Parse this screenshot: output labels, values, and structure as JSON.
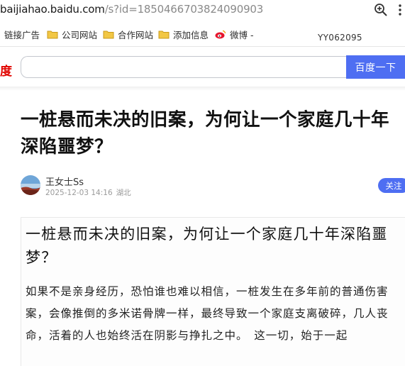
{
  "browser": {
    "url_host": "baijiahao.baidu.com",
    "url_rest": "/s?id=1850466703824090903",
    "zoom_icon": "zoom-in-icon",
    "menu_icon": "more-vertical-icon"
  },
  "bookmarks": {
    "items": [
      {
        "label": "链接广告"
      },
      {
        "label": "公司网站"
      },
      {
        "label": "合作网站"
      },
      {
        "label": "添加信息"
      },
      {
        "label": "微博 -"
      }
    ],
    "right_text": "YY062095"
  },
  "search": {
    "logo_fragment": "度",
    "input_value": "",
    "button_label": "百度一下"
  },
  "article": {
    "title": "一桩悬而未决的旧案，为何让一个家庭几十年深陷噩梦？",
    "author": "王女士Ss",
    "date": "2025-12-03 14:16",
    "location": "湖北",
    "follow_label": "关注",
    "image_title": "一桩悬而未决的旧案，为何让一个家庭几十年深陷噩梦？",
    "image_body": "如果不是亲身经历，恐怕谁也难以相信，一桩发生在多年前的普通伤害案，会像推倒的多米诺骨牌一样，最终导致一个家庭支离破碎，几人丧命，活着的人也始终活在阴影与挣扎之中。　这一切，始于一起"
  },
  "colors": {
    "accent": "#4e6ef2",
    "baidu_red": "#e10601",
    "folder": "#f2c744"
  }
}
